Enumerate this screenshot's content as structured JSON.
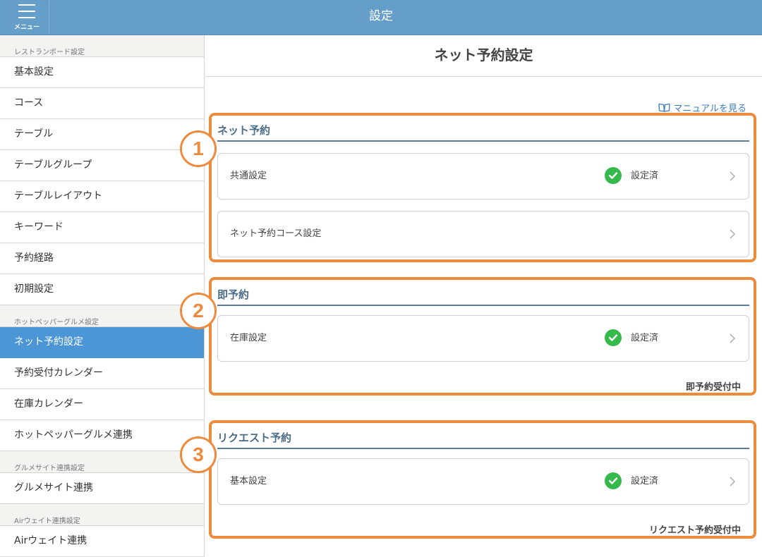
{
  "header": {
    "title": "設定",
    "menu_label": "メニュー"
  },
  "sidebar": {
    "sections": [
      {
        "header": "レストランボード設定",
        "items": [
          "基本設定",
          "コース",
          "テーブル",
          "テーブルグループ",
          "テーブルレイアウト",
          "キーワード",
          "予約経路",
          "初期設定"
        ]
      },
      {
        "header": "ホットペッパーグルメ設定",
        "items": [
          "ネット予約設定",
          "予約受付カレンダー",
          "在庫カレンダー",
          "ホットペッパーグルメ連携"
        ]
      },
      {
        "header": "グルメサイト連携設定",
        "items": [
          "グルメサイト連携"
        ]
      },
      {
        "header": "Airウェイト連携設定",
        "items": [
          "Airウェイト連携"
        ]
      }
    ],
    "active_item": "ネット予約設定"
  },
  "main": {
    "page_title": "ネット予約設定",
    "manual_link": "マニュアルを見る",
    "boxes": [
      {
        "badge": "1",
        "title": "ネット予約",
        "rows": [
          {
            "label": "共通設定",
            "status": "設定済"
          },
          {
            "label": "ネット予約コース設定",
            "status": ""
          }
        ],
        "footer": ""
      },
      {
        "badge": "2",
        "title": "即予約",
        "rows": [
          {
            "label": "在庫設定",
            "status": "設定済"
          }
        ],
        "footer": "即予約受付中"
      },
      {
        "badge": "3",
        "title": "リクエスト予約",
        "rows": [
          {
            "label": "基本設定",
            "status": "設定済"
          }
        ],
        "footer": "リクエスト予約受付中"
      }
    ]
  },
  "icons": {
    "menu": "hamburger-icon",
    "manual": "book-icon",
    "status": "check-circle-icon",
    "row_arrow": "chevron-right-icon"
  },
  "colors": {
    "header": "#659ec8",
    "active_nav": "#4d96d6",
    "annotation": "#ec8a3e",
    "check": "#35b94d",
    "section_title": "#4a6c86"
  }
}
